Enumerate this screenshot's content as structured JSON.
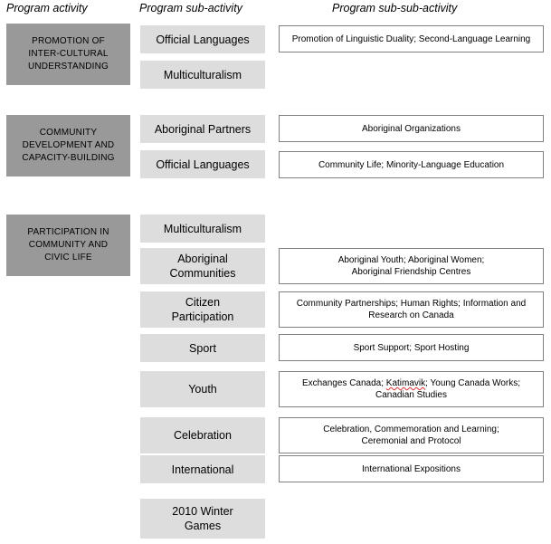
{
  "headers": {
    "activity": "Program activity",
    "sub_activity": "Program sub-activity",
    "sub_sub_activity": "Program sub-sub-activity"
  },
  "colors": {
    "activity_fill": "#999999",
    "sub_activity_fill": "#dddddd",
    "sub_sub_activity_fill": "#ffffff",
    "sub_sub_activity_border": "#808080",
    "text": "#000000",
    "spellcheck_underline": "#e03030"
  },
  "activities": [
    {
      "line1": "PROMOTION OF",
      "line2": "INTER-CULTURAL",
      "line3": "UNDERSTANDING"
    },
    {
      "line1": "COMMUNITY",
      "line2": "DEVELOPMENT AND",
      "line3": "CAPACITY-BUILDING"
    },
    {
      "line1": "PARTICIPATION IN",
      "line2": "COMMUNITY AND",
      "line3": "CIVIC LIFE"
    }
  ],
  "sub_activities": [
    {
      "line1": "Official Languages",
      "line2": ""
    },
    {
      "line1": "Multiculturalism",
      "line2": ""
    },
    {
      "line1": "Aboriginal Partners",
      "line2": ""
    },
    {
      "line1": "Official Languages",
      "line2": ""
    },
    {
      "line1": "Multiculturalism",
      "line2": ""
    },
    {
      "line1": "Aboriginal",
      "line2": "Communities"
    },
    {
      "line1": "Citizen",
      "line2": "Participation"
    },
    {
      "line1": "Sport",
      "line2": ""
    },
    {
      "line1": "Youth",
      "line2": ""
    },
    {
      "line1": "Celebration",
      "line2": ""
    },
    {
      "line1": "International",
      "line2": ""
    },
    {
      "line1": "2010 Winter",
      "line2": "Games"
    }
  ],
  "sub_sub_activities": [
    {
      "line1": "Promotion of Linguistic Duality; Second-Language Learning",
      "line2": ""
    },
    {
      "line1": "Aboriginal Organizations",
      "line2": ""
    },
    {
      "line1": "Community Life; Minority-Language Education",
      "line2": ""
    },
    {
      "line1": "Aboriginal Youth; Aboriginal Women;",
      "line2": "Aboriginal Friendship Centres"
    },
    {
      "line1": "Community Partnerships; Human Rights; Information and",
      "line2": "Research on Canada"
    },
    {
      "line1": "Sport Support; Sport Hosting",
      "line2": ""
    },
    {
      "line1_a": "Exchanges Canada; ",
      "line1_misspelled": "Katimavik",
      "line1_b": "; Young Canada Works;",
      "line2": "Canadian Studies"
    },
    {
      "line1": "Celebration, Commemoration and Learning;",
      "line2": "Ceremonial and Protocol"
    },
    {
      "line1": "International Expositions",
      "line2": ""
    }
  ]
}
